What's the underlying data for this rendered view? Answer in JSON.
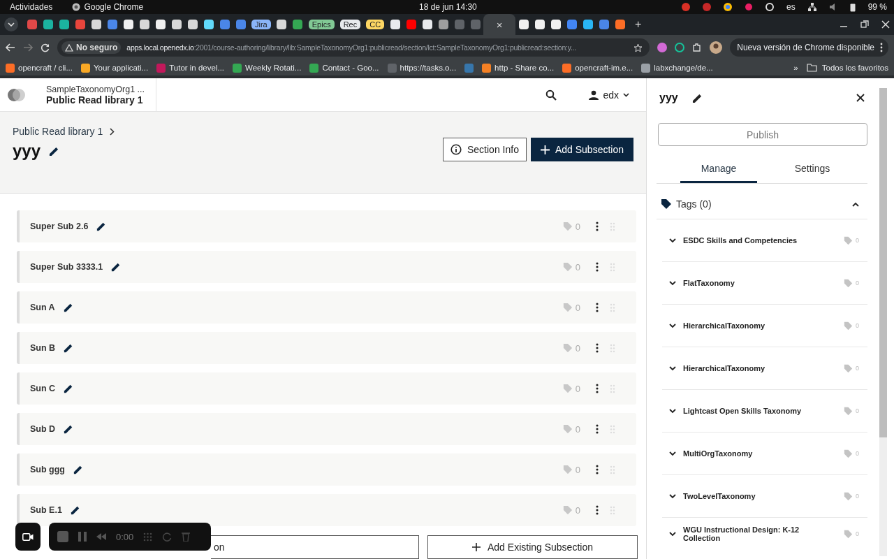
{
  "os_bar": {
    "activities": "Actividades",
    "app": "Google Chrome",
    "clock": "18 de jun  14:30",
    "language": "es",
    "battery": "99 %"
  },
  "browser": {
    "tabs": [
      {
        "kind": "icon",
        "color": "#e04848",
        "selected": false
      },
      {
        "kind": "icon",
        "color": "#1bb3a0",
        "selected": false
      },
      {
        "kind": "icon",
        "color": "#1bb3a0",
        "selected": false
      },
      {
        "kind": "icon",
        "color": "#e8453c",
        "selected": false
      },
      {
        "kind": "icon",
        "color": "#d8d8d8",
        "selected": false
      },
      {
        "kind": "icon",
        "color": "#4a86e8",
        "selected": false
      },
      {
        "kind": "icon",
        "color": "#f0f0f0",
        "selected": false
      },
      {
        "kind": "icon",
        "color": "#d8d8d8",
        "selected": false
      },
      {
        "kind": "icon",
        "color": "#f0f0f0",
        "selected": false
      },
      {
        "kind": "icon",
        "color": "#d8d8d8",
        "selected": false
      },
      {
        "kind": "icon",
        "color": "#d8d8d8",
        "selected": false
      },
      {
        "kind": "icon",
        "color": "#61dafb",
        "selected": false
      },
      {
        "kind": "icon",
        "color": "#4a86e8",
        "selected": false
      },
      {
        "kind": "icon",
        "color": "#4a86e8",
        "selected": false
      },
      {
        "kind": "label",
        "label": "Jira",
        "color": "#8ab4f8",
        "selected": false
      },
      {
        "kind": "icon",
        "color": "#d8d8d8",
        "selected": false
      },
      {
        "kind": "icon",
        "color": "#34a853",
        "selected": false
      },
      {
        "kind": "label",
        "label": "Epics",
        "color": "#81c995",
        "selected": false
      },
      {
        "kind": "label",
        "label": "Rec",
        "color": "#e8eaed",
        "selected": false
      },
      {
        "kind": "label",
        "label": "CC",
        "color": "#fdd663",
        "selected": false
      },
      {
        "kind": "icon",
        "color": "#e8eaed",
        "selected": false
      },
      {
        "kind": "icon",
        "color": "#ff0000",
        "selected": false
      },
      {
        "kind": "icon",
        "color": "#e8eaed",
        "selected": false
      },
      {
        "kind": "icon",
        "color": "#9e9e9e",
        "selected": false
      },
      {
        "kind": "icon",
        "color": "#5f6368",
        "selected": false
      },
      {
        "kind": "icon",
        "color": "#5f6368",
        "selected": false
      },
      {
        "kind": "close",
        "label": "×",
        "selected": true
      },
      {
        "kind": "icon",
        "color": "#f0f0f0",
        "selected": false
      },
      {
        "kind": "icon",
        "color": "#f0f0f0",
        "selected": false
      },
      {
        "kind": "icon",
        "color": "#f0f0f0",
        "selected": false
      },
      {
        "kind": "icon",
        "color": "#4285f4",
        "selected": false
      },
      {
        "kind": "icon",
        "color": "#29b6f6",
        "selected": false
      },
      {
        "kind": "icon",
        "color": "#4a86e8",
        "selected": false
      },
      {
        "kind": "icon",
        "color": "#fc6d26",
        "selected": false
      }
    ],
    "new_tab": "+",
    "security": "No seguro",
    "url_host": "apps.local.openedx.io",
    "url_rest": ":2001/course-authoring/library/lib:SampleTaxonomyOrg1:publicread/section/lct:SampleTaxonomyOrg1:publicread:section:y...",
    "update_button": "Nueva versión de Chrome disponible",
    "bookmarks": [
      {
        "label": "opencraft / cli...",
        "color": "#fc6d26"
      },
      {
        "label": "Your applicati...",
        "color": "#f9a825"
      },
      {
        "label": "Tutor in devel...",
        "color": "#c2185b"
      },
      {
        "label": "Weekly Rotati...",
        "color": "#34a853"
      },
      {
        "label": "Contact - Goo...",
        "color": "#34a853"
      },
      {
        "label": "https://tasks.o...",
        "color": "#5f6368"
      },
      {
        "color": "#3776ab"
      },
      {
        "label": "http - Share co...",
        "color": "#f48024"
      },
      {
        "label": "opencraft-im.e...",
        "color": "#fc6d26"
      },
      {
        "label": "labxchange/de...",
        "color": "#9aa0a6"
      }
    ],
    "bookmarks_more": "»",
    "all_bookmarks": "Todos los favoritos"
  },
  "app_header": {
    "org": "SampleTaxonomyOrg1 ...",
    "library": "Public Read library 1",
    "user": "edx"
  },
  "section": {
    "breadcrumb": "Public Read library 1",
    "title": "yyy",
    "info_button": "Section Info",
    "add_button": "Add Subsection"
  },
  "subsections": [
    {
      "title": "Super Sub 2.6",
      "tag_count": "0"
    },
    {
      "title": "Super Sub 3333.1",
      "tag_count": "0"
    },
    {
      "title": "Sun A",
      "tag_count": "0"
    },
    {
      "title": "Sun B",
      "tag_count": "0"
    },
    {
      "title": "Sun C",
      "tag_count": "0"
    },
    {
      "title": "Sub D",
      "tag_count": "0"
    },
    {
      "title": "Sub ggg",
      "tag_count": "0"
    },
    {
      "title": "Sub E.1",
      "tag_count": "0"
    }
  ],
  "bottom_buttons": {
    "new_visible_part": "on",
    "existing": "Add Existing Subsection"
  },
  "recorder": {
    "time": "0:00"
  },
  "sidebar": {
    "title": "yyy",
    "publish": {
      "label": "Publish",
      "disabled": true
    },
    "tabs": [
      {
        "label": "Manage",
        "selected": true
      },
      {
        "label": "Settings",
        "selected": false
      }
    ],
    "tags": {
      "label": "Tags (0)",
      "expanded": true
    },
    "taxonomies": [
      {
        "name": "ESDC Skills and Competencies",
        "count": "0"
      },
      {
        "name": "FlatTaxonomy",
        "count": "0"
      },
      {
        "name": "HierarchicalTaxonomy",
        "count": "0"
      },
      {
        "name": "HierarchicalTaxonomy",
        "count": "0"
      },
      {
        "name": "Lightcast Open Skills Taxonomy",
        "count": "0"
      },
      {
        "name": "MultiOrgTaxonomy",
        "count": "0"
      },
      {
        "name": "TwoLevelTaxonomy",
        "count": "0"
      },
      {
        "name": "WGU Instructional Design: K-12 Collection",
        "count": "0"
      }
    ]
  }
}
